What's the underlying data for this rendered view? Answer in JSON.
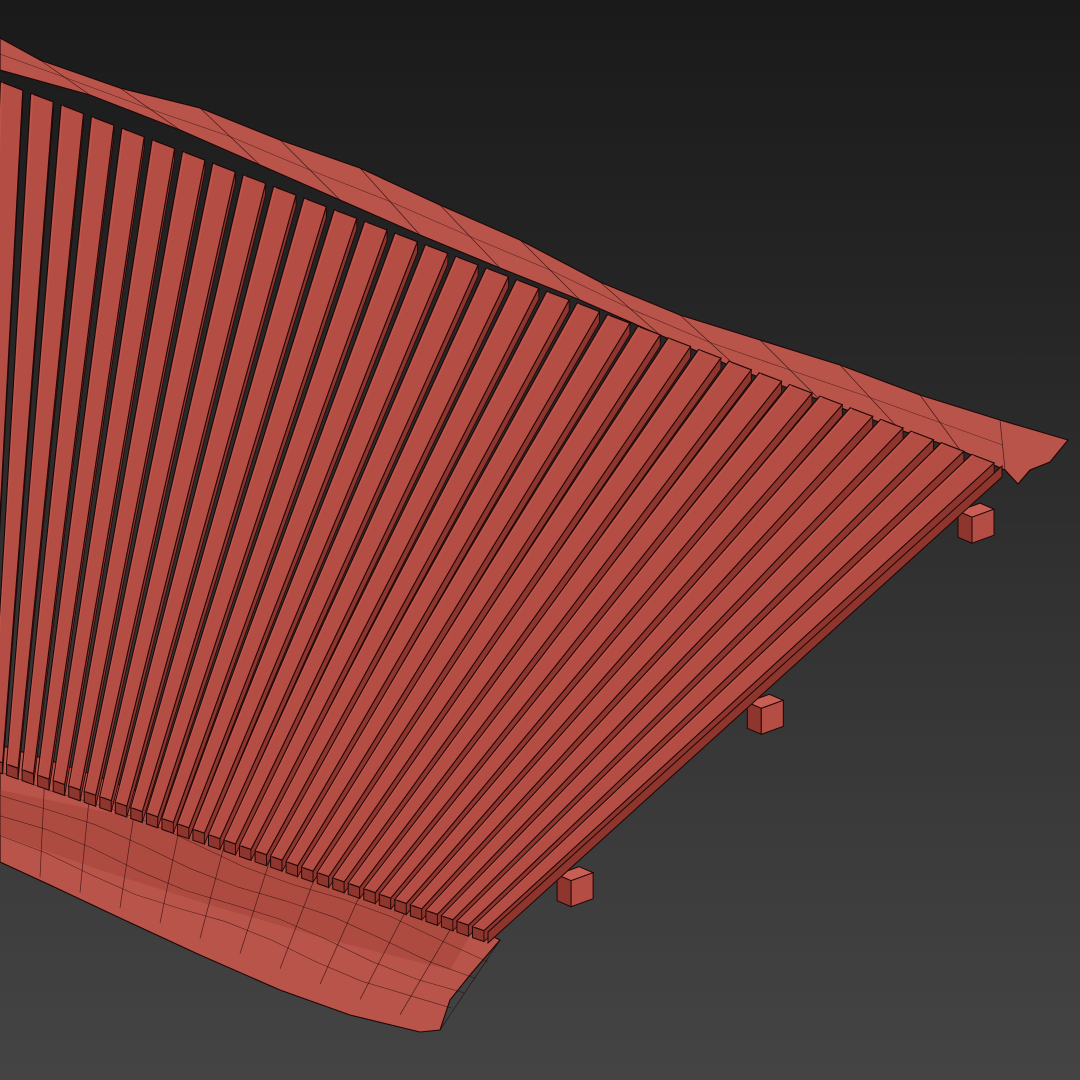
{
  "scene": {
    "subject": "wireframe-wood-deck-on-terrain",
    "plank_count": 34,
    "visible_beam_count": 3,
    "colors": {
      "background_top": "#1a1a1a",
      "background_bottom": "#444444",
      "plank_fill": "#b44d44",
      "plank_dark": "#8e352d",
      "plank_edge_light": "#c85e54",
      "wire": "#1f0606",
      "terrain_fill": "#b8544a",
      "terrain_shade": "#a5443b"
    }
  }
}
